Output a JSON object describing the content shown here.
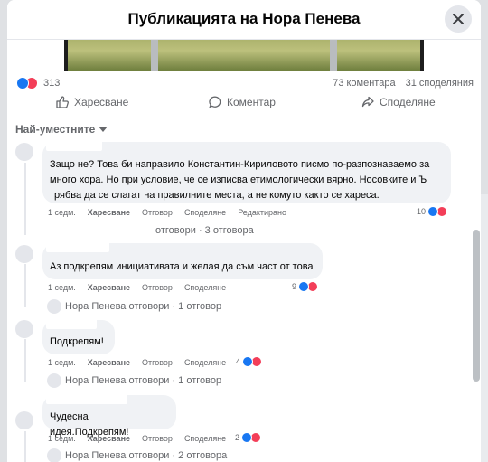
{
  "header": {
    "title": "Публикацията на Нора Пенева"
  },
  "stats": {
    "reactions": "313",
    "comments": "73 коментара",
    "shares": "31 споделяния"
  },
  "actions": {
    "like": "Харесване",
    "comment": "Коментар",
    "share": "Споделяне"
  },
  "sort": {
    "label": "Най-уместните"
  },
  "colors": {
    "like": "#1877f2",
    "love": "#f33e58",
    "bubble": "#f0f2f5",
    "muted": "#65676b"
  },
  "icons": [
    "close-icon",
    "like-icon",
    "comment-icon",
    "share-icon",
    "chevron-down-icon",
    "like-reaction-icon",
    "love-reaction-icon"
  ],
  "comments": [
    {
      "text": "Защо не? Това би направило Константин-Кириловото писмо по-разпознаваемо за много хора. Но при условие, че се изписва етимологически вярно. Носовките и Ъ трябва да се слагат на правилните места, а не комуто както се хареса.",
      "time": "1 седм.",
      "like": "Харесване",
      "reply": "Отговор",
      "share": "Споделяне",
      "edited": "Редактирано",
      "reactions": "10",
      "replies": "отговори · 3 отговора"
    },
    {
      "text": "Аз подкрепям инициативата и желая да съм част от това",
      "time": "1 седм.",
      "like": "Харесване",
      "reply": "Отговор",
      "share": "Споделяне",
      "reactions": "9",
      "replies": "Нора Пенева отговори · 1 отговор"
    },
    {
      "text": "Подкрепям!",
      "time": "1 седм.",
      "like": "Харесване",
      "reply": "Отговор",
      "share": "Споделяне",
      "reactions": "4",
      "replies": "Нора Пенева отговори · 1 отговор"
    },
    {
      "text": "Чудесна идея.Подкрепям!",
      "time": "1 седм.",
      "like": "Харесване",
      "reply": "Отговор",
      "share": "Споделяне",
      "reactions": "2",
      "replies": "Нора Пенева отговори · 2 отговора"
    }
  ]
}
